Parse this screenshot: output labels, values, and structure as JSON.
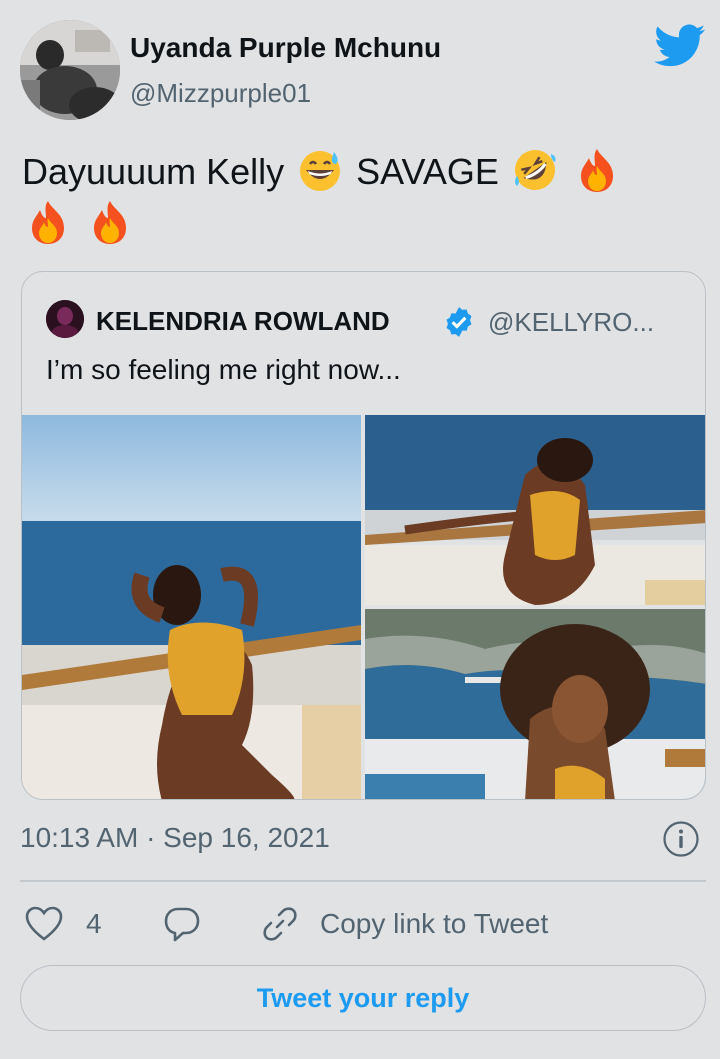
{
  "tweet": {
    "author_name": "Uyanda Purple Mchunu",
    "author_handle": "@Mizzpurple01",
    "text_part1": "Dayuuuum Kelly",
    "text_part2": "SAVAGE",
    "emojis": [
      "grinning-sweat-emoji",
      "rolling-on-floor-laughing-emoji",
      "fire-emoji",
      "fire-emoji",
      "fire-emoji"
    ]
  },
  "quote": {
    "author_name": "KELENDRIA ROWLAND",
    "author_handle": "@KELLYRO...",
    "verified": true,
    "text": "I’m so feeling me right now..."
  },
  "meta": {
    "timestamp": "10:13 AM · Sep 16, 2021"
  },
  "actions": {
    "like_count": "4",
    "copy_link_label": "Copy link to Tweet",
    "reply_button_label": "Tweet your reply"
  },
  "colors": {
    "background": "#e1e2e4",
    "brand": "#1d9bf0",
    "secondary_text": "#536471",
    "primary_text": "#0f1419"
  }
}
